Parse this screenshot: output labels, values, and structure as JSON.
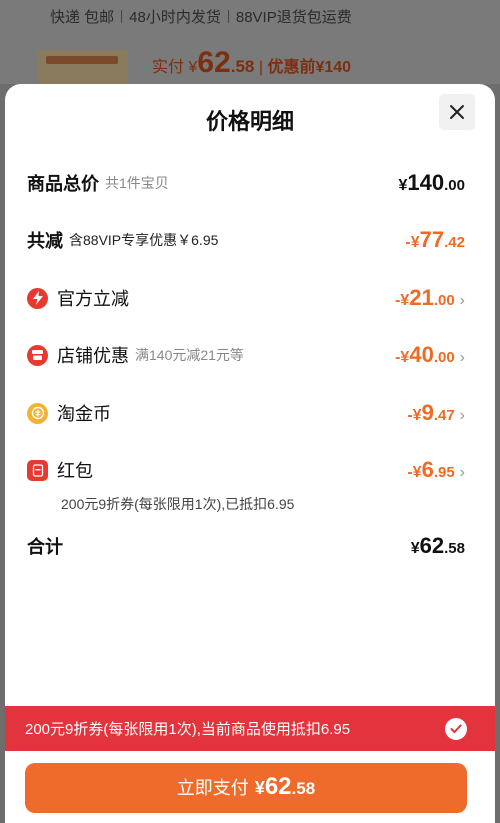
{
  "background": {
    "shipping_items": [
      "快递 包邮",
      "48小时内发货",
      "88VIP退货包运费"
    ],
    "pay_label": "实付",
    "pay_currency": "¥",
    "pay_int": "62",
    "pay_dec": ".58",
    "divider": "|",
    "before_label": "优惠前",
    "before_value": "¥140"
  },
  "sheet": {
    "title": "价格明细",
    "close_icon": "close-icon",
    "total": {
      "label": "商品总价",
      "sub": "共1件宝贝",
      "cur": "¥",
      "int": "140",
      "dec": ".00"
    },
    "discount_total": {
      "label": "共减",
      "sub": "含88VIP专享优惠￥6.95",
      "cur": "-¥",
      "int": "77",
      "dec": ".42"
    },
    "items": [
      {
        "label": "官方立减",
        "sub": "",
        "cur": "-¥",
        "int": "21",
        "dec": ".00",
        "icon": "lightning-icon"
      },
      {
        "label": "店铺优惠",
        "sub": "满140元减21元等",
        "cur": "-¥",
        "int": "40",
        "dec": ".00",
        "icon": "shop-icon"
      },
      {
        "label": "淘金币",
        "sub": "",
        "cur": "-¥",
        "int": "9",
        "dec": ".47",
        "icon": "coin-icon"
      },
      {
        "label": "红包",
        "sub": "",
        "cur": "-¥",
        "int": "6",
        "dec": ".95",
        "icon": "red-packet-icon"
      }
    ],
    "red_packet_note": "200元9折券(每张限用1次),已抵扣6.95",
    "sum": {
      "label": "合计",
      "cur": "¥",
      "int": "62",
      "dec": ".58"
    }
  },
  "banner": {
    "text": "200元9折券(每张限用1次),当前商品使用抵扣6.95",
    "check_icon": "check-circle-icon"
  },
  "pay_button": {
    "label": "立即支付",
    "cur": "¥",
    "int": "62",
    "dec": ".58"
  },
  "colors": {
    "accent_orange": "#ef6a24",
    "banner_red": "#e3333d",
    "button_orange": "#ef6b2c"
  }
}
